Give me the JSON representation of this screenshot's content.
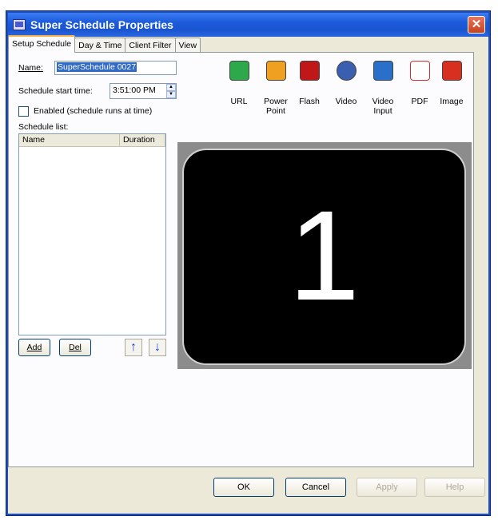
{
  "window": {
    "title": "Super Schedule Properties",
    "close_glyph": "✕"
  },
  "tabs": [
    {
      "label": "Setup Schedule"
    },
    {
      "label": "Day & Time"
    },
    {
      "label": "Client Filter"
    },
    {
      "label": "View"
    }
  ],
  "form": {
    "name_label": "Name:",
    "name_value": "SuperSchedule 0027",
    "start_time_label": "Schedule start time:",
    "start_time_value": "3:51:00 PM",
    "enabled_label": "Enabled (schedule runs at time)",
    "enabled_checked": false,
    "schedule_list_label": "Schedule list:"
  },
  "schedule_list": {
    "columns": [
      "Name",
      "Duration"
    ],
    "rows": []
  },
  "list_buttons": {
    "add": "Add",
    "del": "Del",
    "up": "↑",
    "down": "↓"
  },
  "toolbar": [
    {
      "label": "URL",
      "icon": "url-icon",
      "color": "#2da84a"
    },
    {
      "label": "Power Point",
      "icon": "powerpoint-icon",
      "color": "#f0a020"
    },
    {
      "label": "Flash",
      "icon": "flash-icon",
      "color": "#c01818"
    },
    {
      "label": "Video",
      "icon": "video-icon",
      "color": "#3a5fb0"
    },
    {
      "label": "Video Input",
      "icon": "video-input-icon",
      "color": "#2a6fc8"
    },
    {
      "label": "PDF",
      "icon": "pdf-icon",
      "color": "#d82a2a"
    },
    {
      "label": "Image",
      "icon": "image-icon",
      "color": "#d83020"
    }
  ],
  "preview": {
    "number": "1"
  },
  "dialog_buttons": {
    "ok": "OK",
    "cancel": "Cancel",
    "apply": "Apply",
    "help": "Help"
  }
}
